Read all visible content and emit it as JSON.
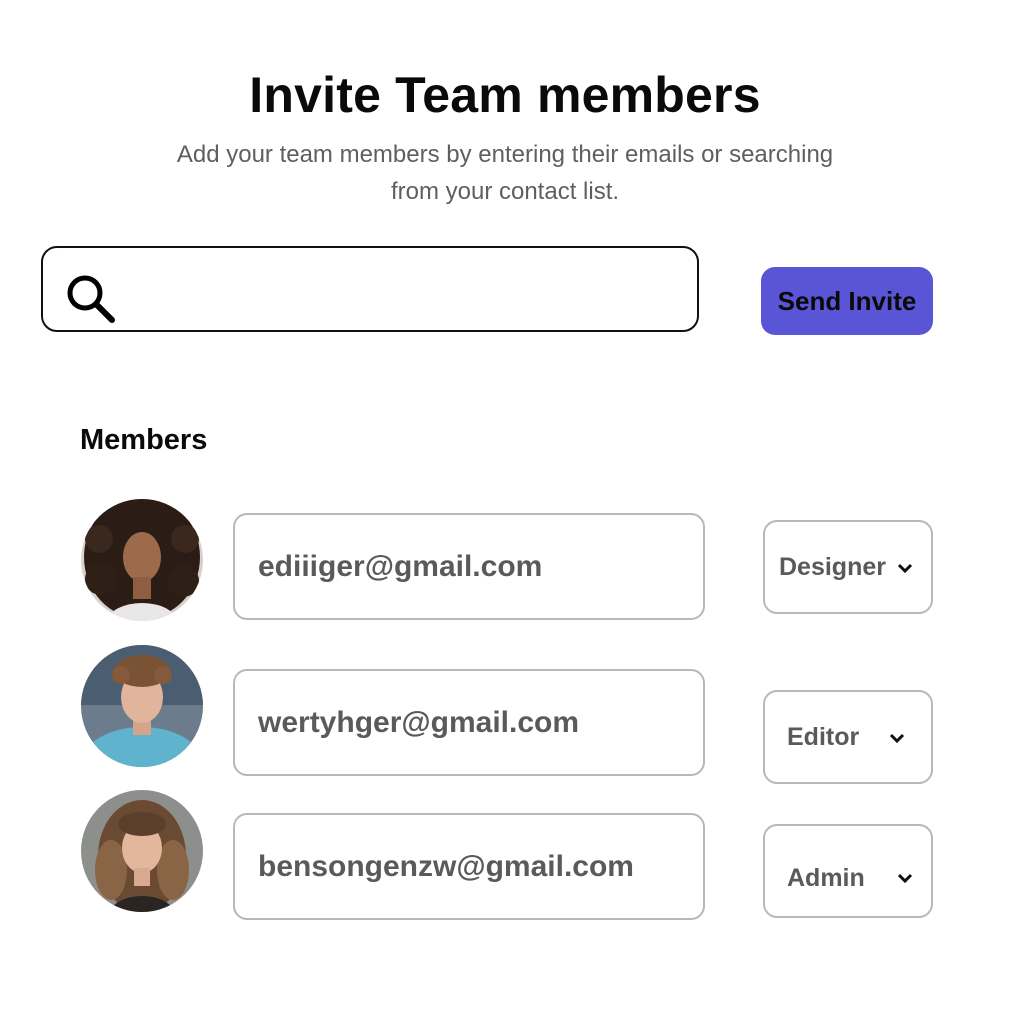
{
  "header": {
    "title": "Invite Team members",
    "subtitle": "Add your team members by entering their emails or searching from your contact list."
  },
  "search": {
    "value": "",
    "placeholder": "",
    "icon": "search-icon"
  },
  "actions": {
    "send_invite_label": "Send Invite",
    "send_invite_color": "#5a55d6"
  },
  "members": {
    "heading": "Members",
    "list": [
      {
        "email": "ediiiger@gmail.com",
        "role": "Designer",
        "avatar": "avatar-curly-hair-woman"
      },
      {
        "email": "wertyhger@gmail.com",
        "role": "Editor",
        "avatar": "avatar-young-man-blue-shirt"
      },
      {
        "email": "bensongenzw@gmail.com",
        "role": "Admin",
        "avatar": "avatar-woman-wavy-hair"
      }
    ]
  }
}
